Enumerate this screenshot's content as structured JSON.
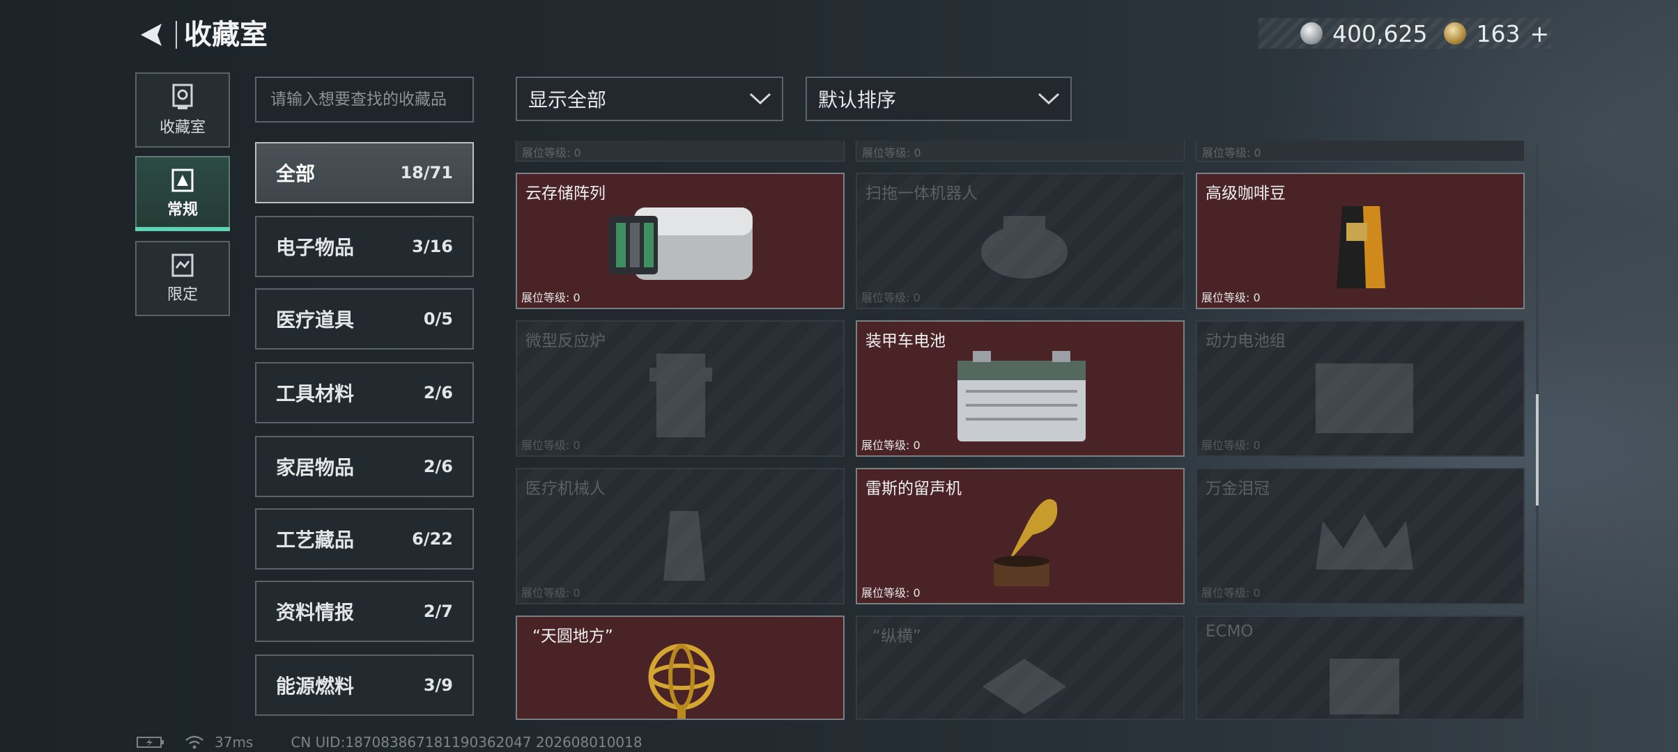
{
  "header": {
    "title": "收藏室",
    "currency_silver": "400,625",
    "currency_gold": "163",
    "add_label": "+"
  },
  "left_nav": [
    {
      "label": "收藏室",
      "icon": "collection-room-icon"
    },
    {
      "label": "常规",
      "icon": "regular-icon"
    },
    {
      "label": "限定",
      "icon": "limited-icon"
    }
  ],
  "search": {
    "placeholder": "请输入想要查找的收藏品"
  },
  "categories": [
    {
      "name": "全部",
      "count": "18/71"
    },
    {
      "name": "电子物品",
      "count": "3/16"
    },
    {
      "name": "医疗道具",
      "count": "0/5"
    },
    {
      "name": "工具材料",
      "count": "2/6"
    },
    {
      "name": "家居物品",
      "count": "2/6"
    },
    {
      "name": "工艺藏品",
      "count": "6/22"
    },
    {
      "name": "资料情报",
      "count": "2/7"
    },
    {
      "name": "能源燃料",
      "count": "3/9"
    }
  ],
  "filters": {
    "display": "显示全部",
    "sort": "默认排序"
  },
  "top_stubs": [
    "展位等级: 0",
    "展位等级: 0",
    "展位等级: 0"
  ],
  "items": [
    {
      "name": "云存储阵列",
      "level": "展位等级: 0",
      "owned": true
    },
    {
      "name": "扫拖一体机器人",
      "level": "展位等级: 0",
      "owned": false
    },
    {
      "name": "高级咖啡豆",
      "level": "展位等级: 0",
      "owned": true
    },
    {
      "name": "微型反应炉",
      "level": "展位等级: 0",
      "owned": false
    },
    {
      "name": "装甲车电池",
      "level": "展位等级: 0",
      "owned": true
    },
    {
      "name": "动力电池组",
      "level": "展位等级: 0",
      "owned": false
    },
    {
      "name": "医疗机械人",
      "level": "展位等级: 0",
      "owned": false
    },
    {
      "name": "雷斯的留声机",
      "level": "展位等级: 0",
      "owned": true
    },
    {
      "name": "万金泪冠",
      "level": "展位等级: 0",
      "owned": false
    },
    {
      "name": "“天圆地方”",
      "level": "",
      "owned": true
    },
    {
      "name": "“纵横”",
      "level": "",
      "owned": false
    },
    {
      "name": "ECMO",
      "level": "",
      "owned": false
    }
  ],
  "footer": {
    "ping": "37ms",
    "uid": "CN UID:187083867181190362047 202608010018"
  },
  "colors": {
    "accent": "#5fd3b3",
    "owned_card": "#4a2327",
    "background": "#222a30"
  }
}
